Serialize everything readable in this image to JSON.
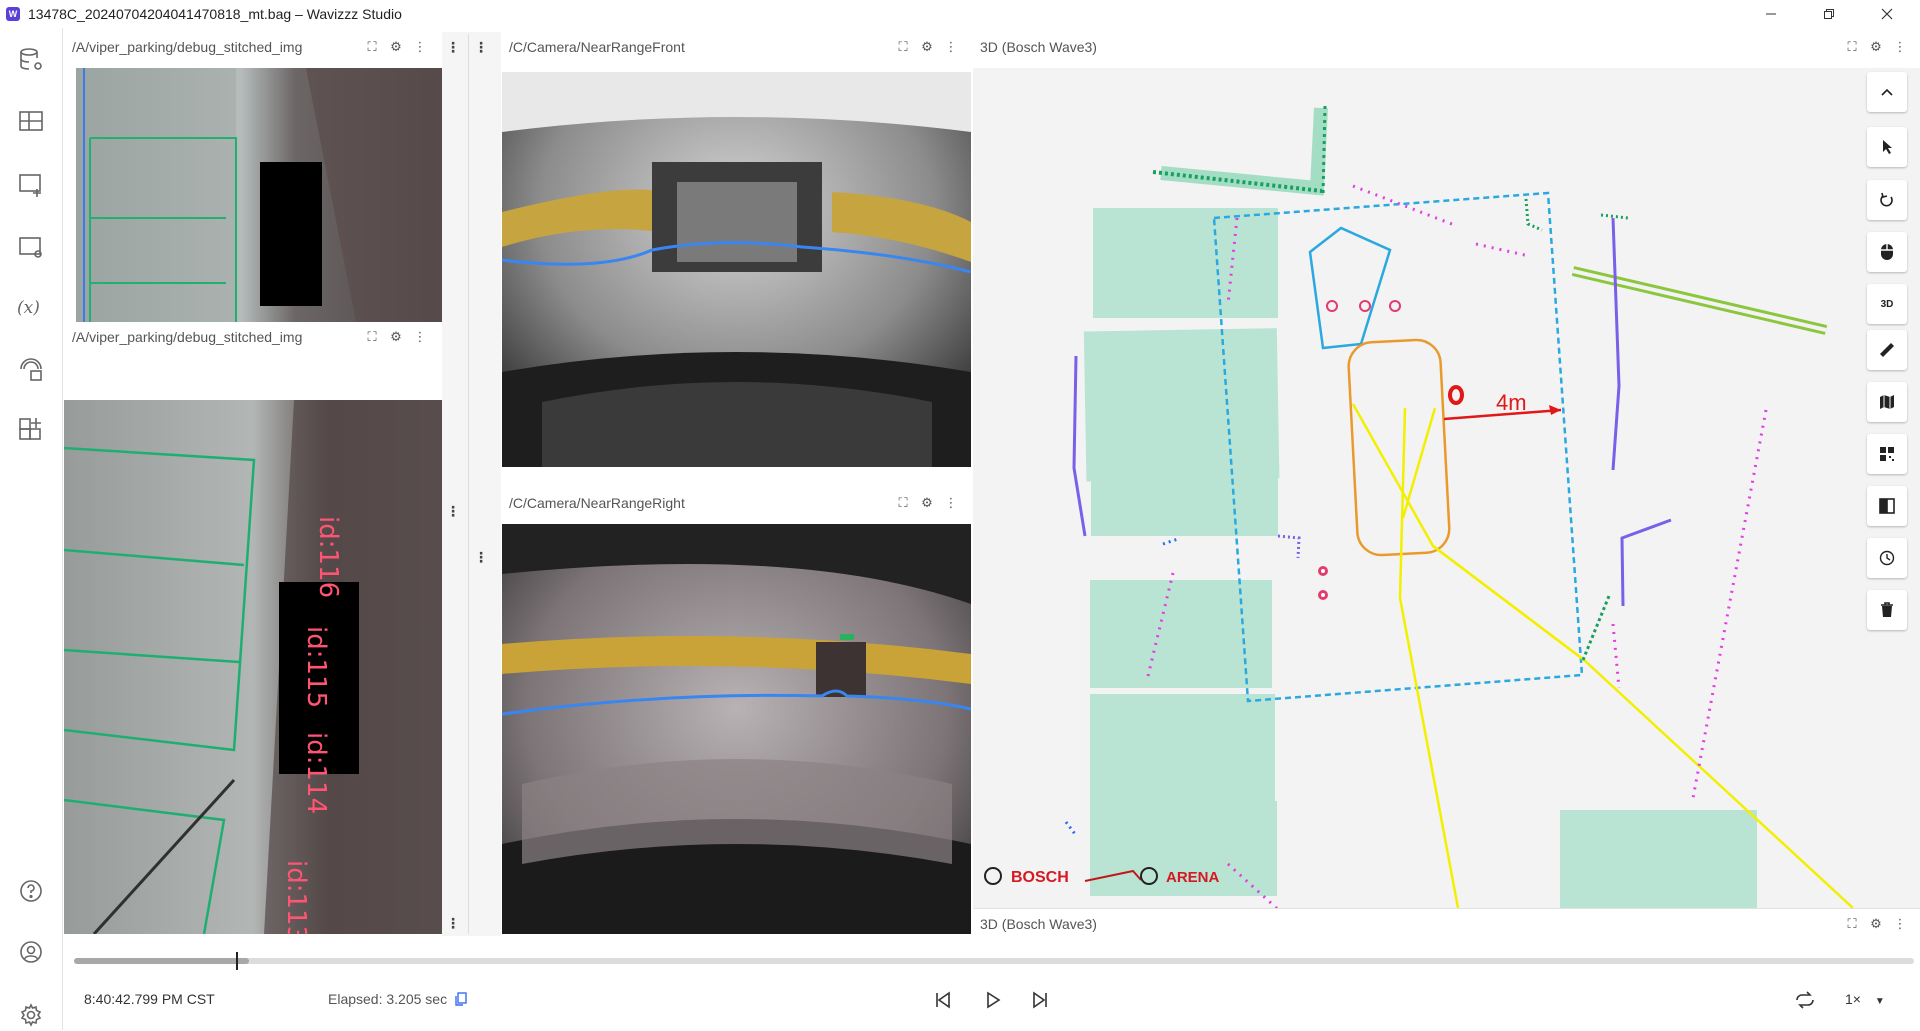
{
  "window": {
    "title": "13478C_20240704204041470818_mt.bag – Wavizzz Studio",
    "logo": "W"
  },
  "panels": {
    "stitched_top": {
      "title": "/A/viper_parking/debug_stitched_img"
    },
    "stitched_bottom": {
      "title": "/A/viper_parking/debug_stitched_img",
      "overlay_ids": [
        "id:116",
        "id:115",
        "id:114",
        "id:113"
      ]
    },
    "front_cam": {
      "title": "/C/Camera/NearRangeFront"
    },
    "right_cam": {
      "title": "/C/Camera/NearRangeRight"
    },
    "view3d": {
      "title": "3D (Bosch Wave3)",
      "distance_label": "4m",
      "logos": [
        "BOSCH",
        "ARENA"
      ],
      "toolbar": [
        "collapse-icon",
        "select-icon",
        "rotate-icon",
        "mouse-icon",
        "3d-toggle",
        "ruler-icon",
        "map-icon",
        "qr-icon",
        "compare-icon",
        "history-icon",
        "delete-icon"
      ],
      "toolbar_3d_label": "3D"
    },
    "view3d_bottom": {
      "title": "3D (Bosch Wave3)"
    }
  },
  "playback": {
    "timestamp": "8:40:42.799 PM CST",
    "elapsed": "Elapsed: 3.205 sec",
    "speed": "1×",
    "progress": 0.088,
    "buffered": 0.095
  },
  "colors": {
    "accent": "#5b3fd6",
    "parking_slot": "#b9e4d4",
    "route_cyan": "#2aa8e0",
    "ego_orange": "#e89a2c",
    "ray_yellow": "#f2f000",
    "arrow_red": "#e01818",
    "lane_green": "#8cc63f",
    "dots_magenta": "#e23ce2",
    "dots_purple": "#7a60e8",
    "dots_green": "#18a060"
  }
}
